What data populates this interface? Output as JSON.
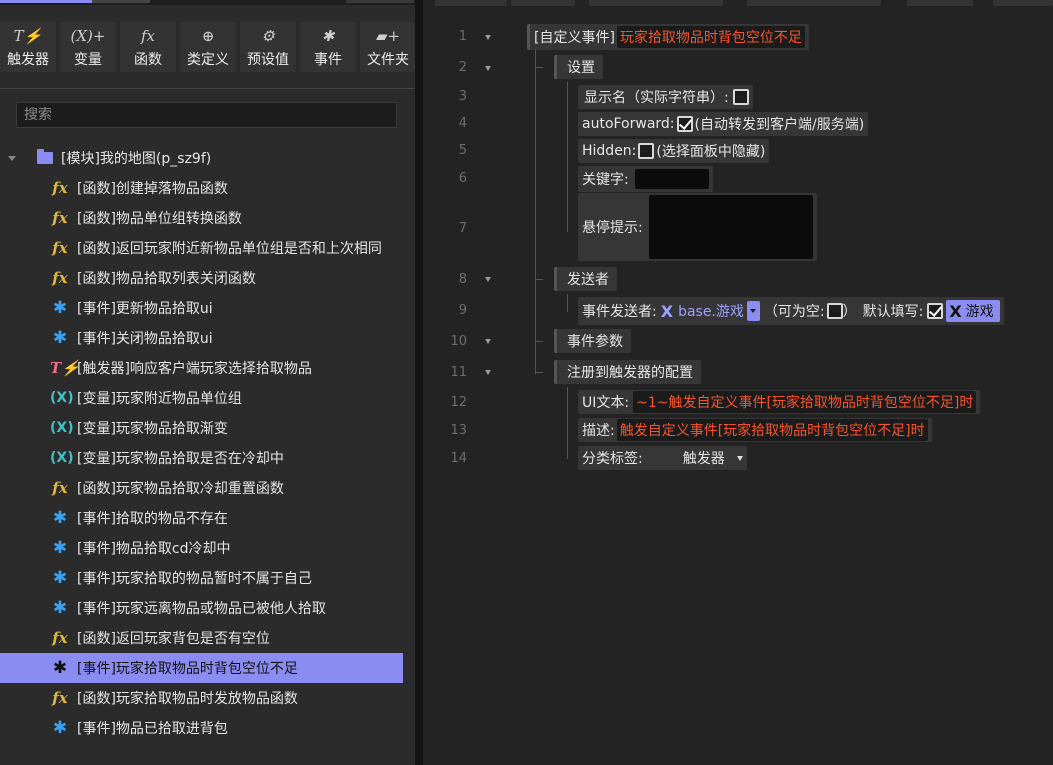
{
  "toolbar": {
    "items": [
      {
        "label": "触发器",
        "icon": "trigger-icon",
        "glyph": "T⚡"
      },
      {
        "label": "变量",
        "icon": "variable-icon",
        "glyph": "(X)+"
      },
      {
        "label": "函数",
        "icon": "function-icon",
        "glyph": "fx"
      },
      {
        "label": "类定义",
        "icon": "class-icon",
        "glyph": "⊕"
      },
      {
        "label": "预设值",
        "icon": "preset-icon",
        "glyph": "⚙"
      },
      {
        "label": "事件",
        "icon": "event-icon",
        "glyph": "✱"
      },
      {
        "label": "文件夹",
        "icon": "folder-add-icon",
        "glyph": "▰+"
      }
    ]
  },
  "search": {
    "placeholder": "搜索"
  },
  "tree": {
    "root_label": "[模块]我的地图(p_sz9f)",
    "items": [
      {
        "type": "fx",
        "label": "[函数]创建掉落物品函数"
      },
      {
        "type": "fx",
        "label": "[函数]物品单位组转换函数"
      },
      {
        "type": "fx",
        "label": "[函数]返回玩家附近新物品单位组是否和上次相同"
      },
      {
        "type": "fx",
        "label": "[函数]物品拾取列表关闭函数"
      },
      {
        "type": "ev",
        "label": "[事件]更新物品拾取ui"
      },
      {
        "type": "ev",
        "label": "[事件]关闭物品拾取ui"
      },
      {
        "type": "tr",
        "label": "[触发器]响应客户端玩家选择拾取物品"
      },
      {
        "type": "var",
        "label": "[变量]玩家附近物品单位组"
      },
      {
        "type": "var",
        "label": "[变量]玩家物品拾取渐变"
      },
      {
        "type": "var",
        "label": "[变量]玩家物品拾取是否在冷却中"
      },
      {
        "type": "fx",
        "label": "[函数]玩家物品拾取冷却重置函数"
      },
      {
        "type": "ev",
        "label": "[事件]拾取的物品不存在"
      },
      {
        "type": "ev",
        "label": "[事件]物品拾取cd冷却中"
      },
      {
        "type": "ev",
        "label": "[事件]玩家拾取的物品暂时不属于自己"
      },
      {
        "type": "ev",
        "label": "[事件]玩家远离物品或物品已被他人拾取"
      },
      {
        "type": "fx",
        "label": "[函数]返回玩家背包是否有空位"
      },
      {
        "type": "ev",
        "label": "[事件]玩家拾取物品时背包空位不足",
        "selected": true
      },
      {
        "type": "fx",
        "label": "[函数]玩家拾取物品时发放物品函数"
      },
      {
        "type": "ev",
        "label": "[事件]物品已拾取进背包"
      }
    ]
  },
  "icon_glyphs": {
    "fx": "fx",
    "ev": "✱",
    "tr": "T⚡",
    "var": "(X)"
  },
  "editor": {
    "line_numbers": [
      "1",
      "2",
      "3",
      "4",
      "5",
      "6",
      "7",
      "8",
      "9",
      "10",
      "11",
      "12",
      "13",
      "14"
    ],
    "custom_event_tag": "[自定义事件]",
    "custom_event_name": "玩家拾取物品时背包空位不足",
    "settings_label": "设置",
    "display_name_label": "显示名（实际字符串）:",
    "display_name_checked": false,
    "auto_forward_label": "autoForward:",
    "auto_forward_checked": true,
    "auto_forward_note": "(自动转发到客户端/服务端)",
    "hidden_label": "Hidden:",
    "hidden_checked": false,
    "hidden_note": "(选择面板中隐藏)",
    "keyword_label": "关键字:",
    "tooltip_label": "悬停提示:",
    "sender_label": "发送者",
    "event_sender_label": "事件发送者:",
    "event_sender_value": "base.游戏",
    "nullable_label": "（可为空:",
    "nullable_checked": false,
    "nullable_close": "）",
    "default_fill_label": "默认填写:",
    "default_fill_checked": true,
    "default_fill_value": "游戏",
    "params_label": "事件参数",
    "register_label": "注册到触发器的配置",
    "ui_text_label": "UI文本:",
    "ui_text_value": "~1~触发自定义事件[玩家拾取物品时背包空位不足]时",
    "desc_label": "描述:",
    "desc_value": "触发自定义事件[玩家拾取物品时背包空位不足]时",
    "category_label": "分类标签:",
    "category_value": "触发器"
  },
  "colors": {
    "accent": "#8b8cf2",
    "event_name_red": "#f2562e",
    "fx_yellow": "#e2b93b",
    "event_blue": "#3aa2f2",
    "trigger_pink": "#f06b8a",
    "var_teal": "#3fc2c8"
  }
}
